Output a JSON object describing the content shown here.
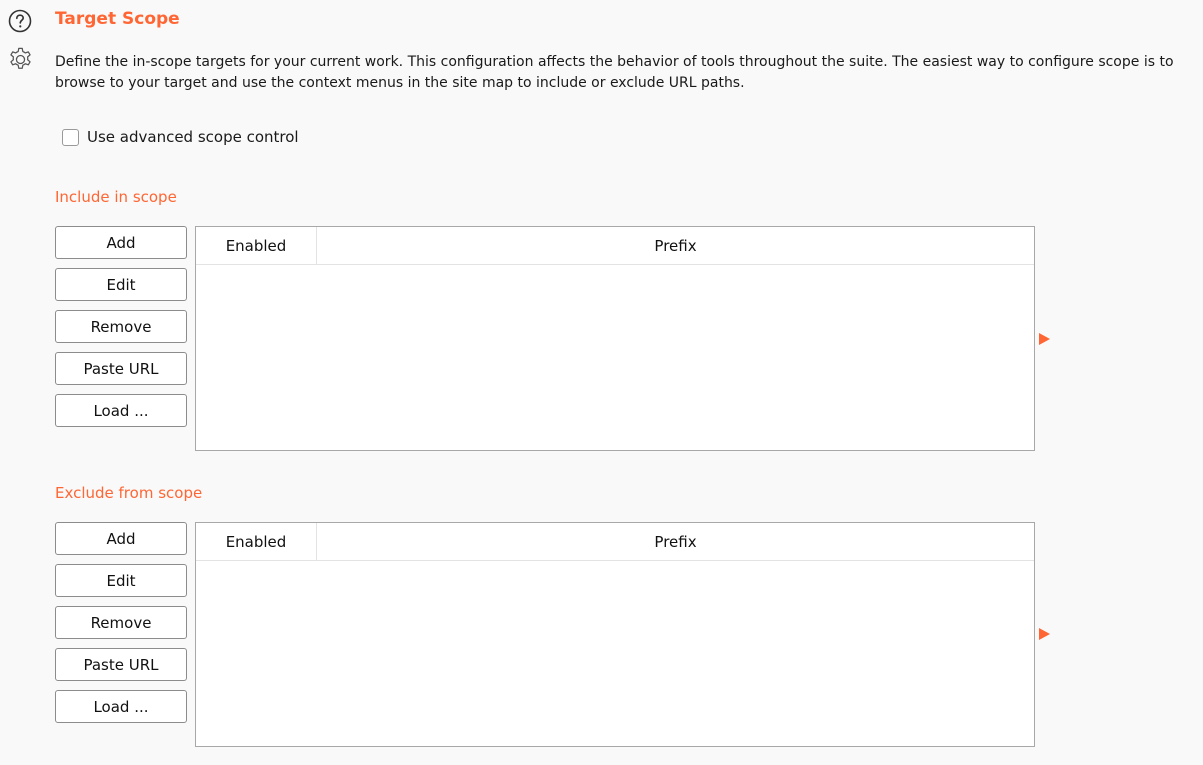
{
  "header": {
    "title": "Target Scope",
    "description": "Define the in-scope targets for your current work. This configuration affects the behavior of tools throughout the suite. The easiest way to configure scope is to browse to your target and use the context menus in the site map to include or exclude URL paths."
  },
  "advanced": {
    "label": "Use advanced scope control",
    "checked": false
  },
  "include": {
    "label": "Include in scope",
    "buttons": {
      "add": "Add",
      "edit": "Edit",
      "remove": "Remove",
      "paste": "Paste URL",
      "load": "Load ..."
    },
    "columns": {
      "enabled": "Enabled",
      "prefix": "Prefix"
    },
    "rows": []
  },
  "exclude": {
    "label": "Exclude from scope",
    "buttons": {
      "add": "Add",
      "edit": "Edit",
      "remove": "Remove",
      "paste": "Paste URL",
      "load": "Load ..."
    },
    "columns": {
      "enabled": "Enabled",
      "prefix": "Prefix"
    },
    "rows": []
  },
  "colors": {
    "accent": "#ff6633",
    "background": "#f9f9f9",
    "border": "#8c8c8c"
  },
  "icons": [
    "help-icon",
    "gear-icon",
    "expand-arrow-icon"
  ]
}
